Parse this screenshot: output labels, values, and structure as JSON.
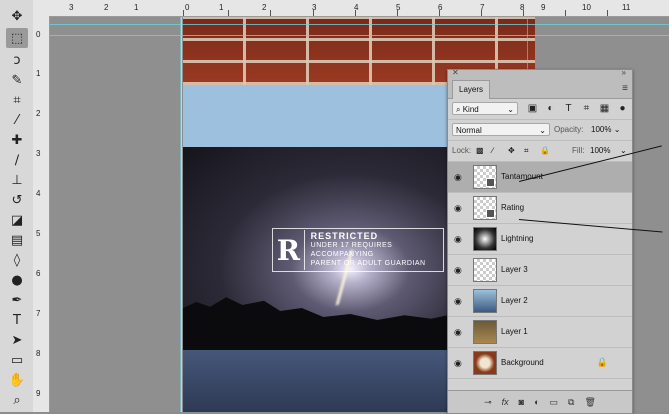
{
  "ruler": {
    "top_labels": [
      "3",
      "2",
      "1",
      "0",
      "1",
      "2",
      "3",
      "4",
      "5",
      "6",
      "7",
      "8",
      "9",
      "10",
      "11"
    ],
    "left_labels": [
      "0",
      "1",
      "2",
      "3",
      "4",
      "5",
      "6",
      "7",
      "8",
      "9"
    ]
  },
  "tools": [
    "move-icon",
    "marquee-icon",
    "lasso-icon",
    "quick-select-icon",
    "crop-icon",
    "eyedropper-icon",
    "healing-icon",
    "brush-icon",
    "stamp-icon",
    "history-brush-icon",
    "eraser-icon",
    "gradient-icon",
    "blur-icon",
    "dodge-icon",
    "pen-icon",
    "type-icon",
    "path-select-icon",
    "shape-icon",
    "hand-icon",
    "zoom-icon"
  ],
  "rating": {
    "letter": "R",
    "line1": "RESTRICTED",
    "line2": "UNDER 17 REQUIRES ACCOMPANYING",
    "line3": "PARENT OR ADULT GUARDIAN"
  },
  "layers_panel": {
    "tab": "Layers",
    "filter_label": "Kind",
    "blend_mode": "Normal",
    "opacity_label": "Opacity:",
    "opacity_value": "100%",
    "lock_label": "Lock:",
    "fill_label": "Fill:",
    "fill_value": "100%",
    "layers": [
      {
        "name": "Tantamount",
        "active": true
      },
      {
        "name": "Rating",
        "active": false
      },
      {
        "name": "Lightning",
        "active": false
      },
      {
        "name": "Layer 3",
        "active": false
      },
      {
        "name": "Layer 2",
        "active": false
      },
      {
        "name": "Layer 1",
        "active": false
      },
      {
        "name": "Background",
        "active": false
      }
    ],
    "bottom_icons": [
      "link-icon",
      "fx-icon",
      "mask-icon",
      "adjustment-icon",
      "folder-icon",
      "new-layer-icon",
      "trash-icon"
    ],
    "bottom_fx": "fx"
  }
}
